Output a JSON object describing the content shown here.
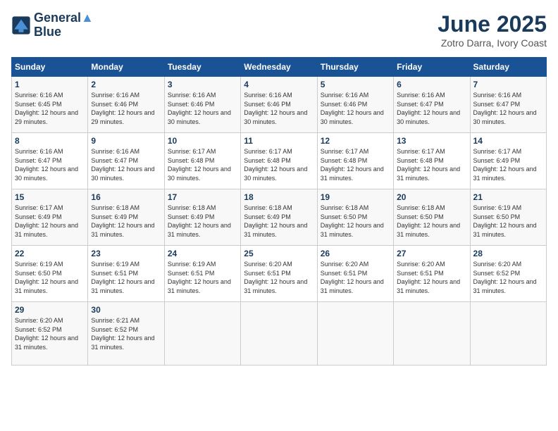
{
  "logo": {
    "line1": "General",
    "line2": "Blue"
  },
  "title": "June 2025",
  "subtitle": "Zotro Darra, Ivory Coast",
  "weekdays": [
    "Sunday",
    "Monday",
    "Tuesday",
    "Wednesday",
    "Thursday",
    "Friday",
    "Saturday"
  ],
  "weeks": [
    [
      {
        "day": "1",
        "sunrise": "6:16 AM",
        "sunset": "6:45 PM",
        "daylight": "12 hours and 29 minutes."
      },
      {
        "day": "2",
        "sunrise": "6:16 AM",
        "sunset": "6:46 PM",
        "daylight": "12 hours and 29 minutes."
      },
      {
        "day": "3",
        "sunrise": "6:16 AM",
        "sunset": "6:46 PM",
        "daylight": "12 hours and 30 minutes."
      },
      {
        "day": "4",
        "sunrise": "6:16 AM",
        "sunset": "6:46 PM",
        "daylight": "12 hours and 30 minutes."
      },
      {
        "day": "5",
        "sunrise": "6:16 AM",
        "sunset": "6:46 PM",
        "daylight": "12 hours and 30 minutes."
      },
      {
        "day": "6",
        "sunrise": "6:16 AM",
        "sunset": "6:47 PM",
        "daylight": "12 hours and 30 minutes."
      },
      {
        "day": "7",
        "sunrise": "6:16 AM",
        "sunset": "6:47 PM",
        "daylight": "12 hours and 30 minutes."
      }
    ],
    [
      {
        "day": "8",
        "sunrise": "6:16 AM",
        "sunset": "6:47 PM",
        "daylight": "12 hours and 30 minutes."
      },
      {
        "day": "9",
        "sunrise": "6:16 AM",
        "sunset": "6:47 PM",
        "daylight": "12 hours and 30 minutes."
      },
      {
        "day": "10",
        "sunrise": "6:17 AM",
        "sunset": "6:48 PM",
        "daylight": "12 hours and 30 minutes."
      },
      {
        "day": "11",
        "sunrise": "6:17 AM",
        "sunset": "6:48 PM",
        "daylight": "12 hours and 30 minutes."
      },
      {
        "day": "12",
        "sunrise": "6:17 AM",
        "sunset": "6:48 PM",
        "daylight": "12 hours and 31 minutes."
      },
      {
        "day": "13",
        "sunrise": "6:17 AM",
        "sunset": "6:48 PM",
        "daylight": "12 hours and 31 minutes."
      },
      {
        "day": "14",
        "sunrise": "6:17 AM",
        "sunset": "6:49 PM",
        "daylight": "12 hours and 31 minutes."
      }
    ],
    [
      {
        "day": "15",
        "sunrise": "6:17 AM",
        "sunset": "6:49 PM",
        "daylight": "12 hours and 31 minutes."
      },
      {
        "day": "16",
        "sunrise": "6:18 AM",
        "sunset": "6:49 PM",
        "daylight": "12 hours and 31 minutes."
      },
      {
        "day": "17",
        "sunrise": "6:18 AM",
        "sunset": "6:49 PM",
        "daylight": "12 hours and 31 minutes."
      },
      {
        "day": "18",
        "sunrise": "6:18 AM",
        "sunset": "6:49 PM",
        "daylight": "12 hours and 31 minutes."
      },
      {
        "day": "19",
        "sunrise": "6:18 AM",
        "sunset": "6:50 PM",
        "daylight": "12 hours and 31 minutes."
      },
      {
        "day": "20",
        "sunrise": "6:18 AM",
        "sunset": "6:50 PM",
        "daylight": "12 hours and 31 minutes."
      },
      {
        "day": "21",
        "sunrise": "6:19 AM",
        "sunset": "6:50 PM",
        "daylight": "12 hours and 31 minutes."
      }
    ],
    [
      {
        "day": "22",
        "sunrise": "6:19 AM",
        "sunset": "6:50 PM",
        "daylight": "12 hours and 31 minutes."
      },
      {
        "day": "23",
        "sunrise": "6:19 AM",
        "sunset": "6:51 PM",
        "daylight": "12 hours and 31 minutes."
      },
      {
        "day": "24",
        "sunrise": "6:19 AM",
        "sunset": "6:51 PM",
        "daylight": "12 hours and 31 minutes."
      },
      {
        "day": "25",
        "sunrise": "6:20 AM",
        "sunset": "6:51 PM",
        "daylight": "12 hours and 31 minutes."
      },
      {
        "day": "26",
        "sunrise": "6:20 AM",
        "sunset": "6:51 PM",
        "daylight": "12 hours and 31 minutes."
      },
      {
        "day": "27",
        "sunrise": "6:20 AM",
        "sunset": "6:51 PM",
        "daylight": "12 hours and 31 minutes."
      },
      {
        "day": "28",
        "sunrise": "6:20 AM",
        "sunset": "6:52 PM",
        "daylight": "12 hours and 31 minutes."
      }
    ],
    [
      {
        "day": "29",
        "sunrise": "6:20 AM",
        "sunset": "6:52 PM",
        "daylight": "12 hours and 31 minutes."
      },
      {
        "day": "30",
        "sunrise": "6:21 AM",
        "sunset": "6:52 PM",
        "daylight": "12 hours and 31 minutes."
      },
      null,
      null,
      null,
      null,
      null
    ]
  ]
}
